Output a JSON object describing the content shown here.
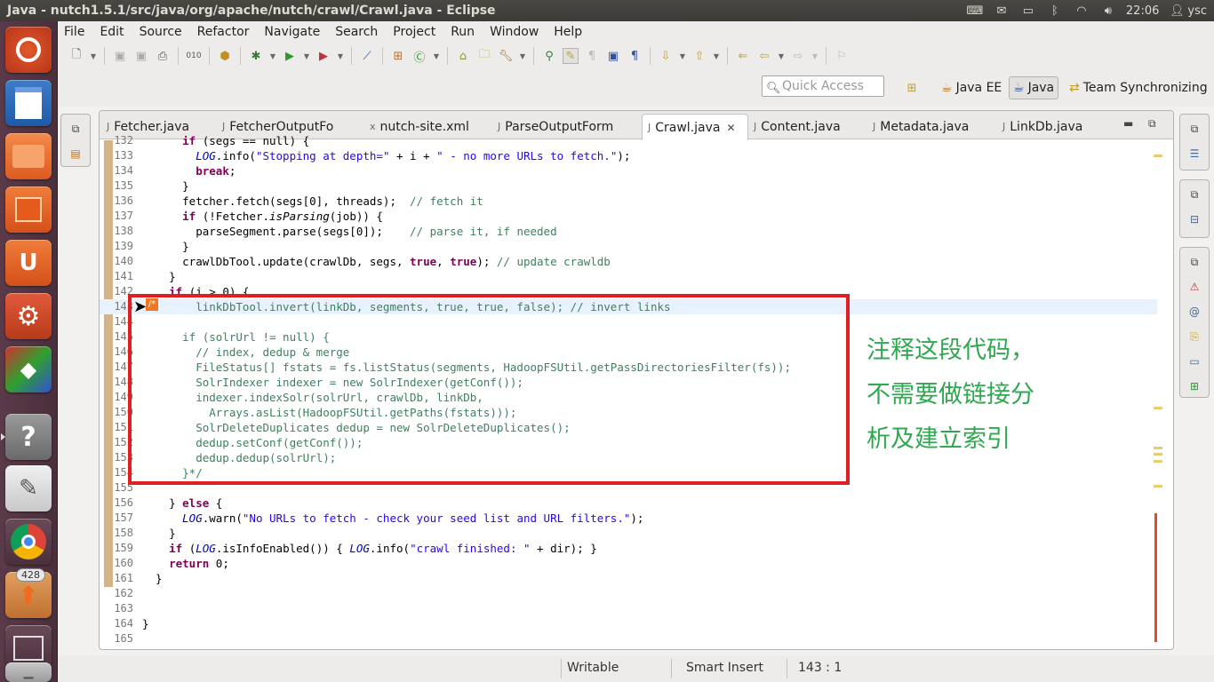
{
  "window": {
    "title": "Java - nutch1.5.1/src/java/org/apache/nutch/crawl/Crawl.java - Eclipse"
  },
  "system": {
    "clock": "22:06",
    "user": "ysc"
  },
  "launcher": {
    "items": [
      {
        "name": "ubuntu-dash",
        "icon": "ubuntu-logo-icon"
      },
      {
        "name": "libreoffice-writer",
        "icon": "document-icon"
      },
      {
        "name": "files",
        "icon": "folder-icon"
      },
      {
        "name": "software-center",
        "icon": "shopping-bag-icon"
      },
      {
        "name": "ubuntu-one",
        "icon": "ubuntu-one-icon",
        "glyph": "U"
      },
      {
        "name": "system-settings",
        "icon": "settings-icon"
      },
      {
        "name": "cube-app",
        "icon": "cube-icon"
      },
      {
        "name": "help",
        "icon": "help-icon",
        "glyph": "?"
      },
      {
        "name": "text-editor",
        "icon": "text-editor-icon"
      },
      {
        "name": "chrome",
        "icon": "chrome-icon"
      },
      {
        "name": "update-manager",
        "icon": "update-icon",
        "badge": "428"
      },
      {
        "name": "workspace-switcher",
        "icon": "workspace-icon"
      },
      {
        "name": "trash",
        "icon": "trash-icon"
      }
    ]
  },
  "menubar": {
    "items": [
      "File",
      "Edit",
      "Source",
      "Refactor",
      "Navigate",
      "Search",
      "Project",
      "Run",
      "Window",
      "Help"
    ]
  },
  "perspectives": {
    "quick_access_placeholder": "Quick Access",
    "items": [
      {
        "label": "Java EE",
        "active": false
      },
      {
        "label": "Java",
        "active": true
      },
      {
        "label": "Team Synchronizing",
        "active": false
      }
    ]
  },
  "tabs": [
    {
      "label": "Fetcher.java",
      "active": false,
      "icon": "java-file-icon"
    },
    {
      "label": "FetcherOutputFo",
      "active": false,
      "icon": "java-file-icon"
    },
    {
      "label": "nutch-site.xml",
      "active": false,
      "icon": "xml-file-icon"
    },
    {
      "label": "ParseOutputForm",
      "active": false,
      "icon": "java-file-icon"
    },
    {
      "label": "Crawl.java",
      "active": true,
      "icon": "java-file-icon"
    },
    {
      "label": "Content.java",
      "active": false,
      "icon": "java-file-icon"
    },
    {
      "label": "Metadata.java",
      "active": false,
      "icon": "java-file-icon"
    },
    {
      "label": "LinkDb.java",
      "active": false,
      "icon": "java-file-icon"
    }
  ],
  "code_lines": [
    {
      "n": "132",
      "text": "      if (segs == null) {"
    },
    {
      "n": "133",
      "text": "        LOG.info(\"Stopping at depth=\" + i + \" - no more URLs to fetch.\");"
    },
    {
      "n": "134",
      "text": "        break;"
    },
    {
      "n": "135",
      "text": "      }"
    },
    {
      "n": "136",
      "text": "      fetcher.fetch(segs[0], threads);  // fetch it"
    },
    {
      "n": "137",
      "text": "      if (!Fetcher.isParsing(job)) {"
    },
    {
      "n": "138",
      "text": "        parseSegment.parse(segs[0]);    // parse it, if needed"
    },
    {
      "n": "139",
      "text": "      }"
    },
    {
      "n": "140",
      "text": "      crawlDbTool.update(crawlDb, segs, true, true); // update crawldb"
    },
    {
      "n": "141",
      "text": "    }"
    },
    {
      "n": "142",
      "text": "    if (i > 0) {"
    },
    {
      "n": "143",
      "text": "        linkDbTool.invert(linkDb, segments, true, true, false); // invert links"
    },
    {
      "n": "144",
      "text": ""
    },
    {
      "n": "145",
      "text": "      if (solrUrl != null) {"
    },
    {
      "n": "146",
      "text": "        // index, dedup & merge"
    },
    {
      "n": "147",
      "text": "        FileStatus[] fstats = fs.listStatus(segments, HadoopFSUtil.getPassDirectoriesFilter(fs));"
    },
    {
      "n": "148",
      "text": "        SolrIndexer indexer = new SolrIndexer(getConf());"
    },
    {
      "n": "149",
      "text": "        indexer.indexSolr(solrUrl, crawlDb, linkDb,"
    },
    {
      "n": "150",
      "text": "          Arrays.asList(HadoopFSUtil.getPaths(fstats)));"
    },
    {
      "n": "151",
      "text": "        SolrDeleteDuplicates dedup = new SolrDeleteDuplicates();"
    },
    {
      "n": "152",
      "text": "        dedup.setConf(getConf());"
    },
    {
      "n": "153",
      "text": "        dedup.dedup(solrUrl);"
    },
    {
      "n": "154",
      "text": "      }*/"
    },
    {
      "n": "155",
      "text": ""
    },
    {
      "n": "156",
      "text": "    } else {"
    },
    {
      "n": "157",
      "text": "      LOG.warn(\"No URLs to fetch - check your seed list and URL filters.\");"
    },
    {
      "n": "158",
      "text": "    }"
    },
    {
      "n": "159",
      "text": "    if (LOG.isInfoEnabled()) { LOG.info(\"crawl finished: \" + dir); }"
    },
    {
      "n": "160",
      "text": "    return 0;"
    },
    {
      "n": "161",
      "text": "  }"
    },
    {
      "n": "162",
      "text": ""
    },
    {
      "n": "163",
      "text": ""
    },
    {
      "n": "164",
      "text": "}"
    },
    {
      "n": "165",
      "text": ""
    }
  ],
  "annotation": {
    "lines": [
      "注释这段代码，",
      "不需要做链接分",
      "析及建立索引"
    ],
    "color": "#2fa84f",
    "box_color": "#e0201e"
  },
  "statusbar": {
    "mode": "Writable",
    "insert": "Smart Insert",
    "position": "143 : 1"
  }
}
